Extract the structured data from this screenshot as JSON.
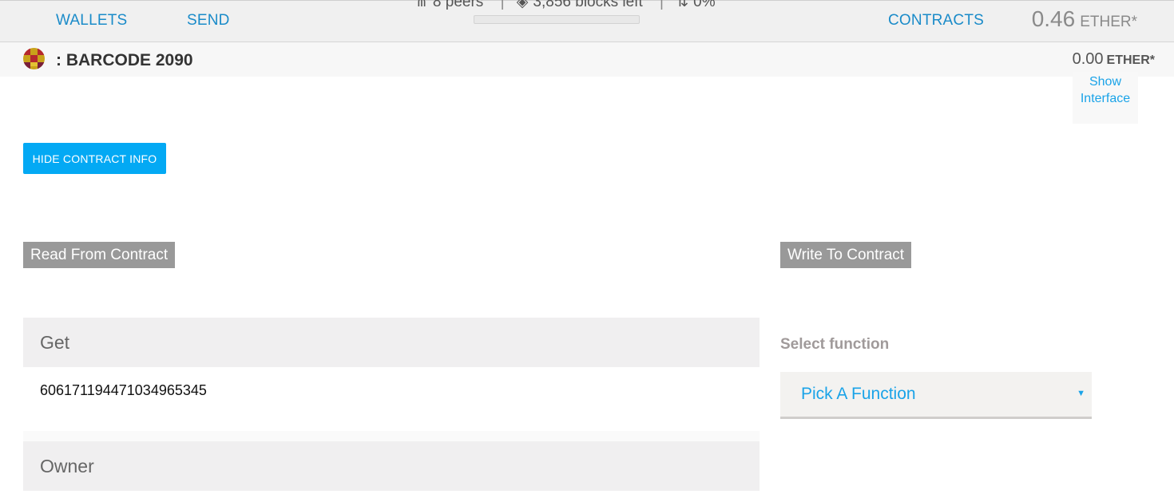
{
  "nav": {
    "wallets": "WALLETS",
    "send": "SEND",
    "contracts": "CONTRACTS",
    "balance_value": "0.46",
    "balance_unit": "ETHER*"
  },
  "status": {
    "peers": "8 peers",
    "blocks_left": "3,856 blocks left",
    "sync": "0%",
    "progress_fraction": 0
  },
  "account": {
    "name": ": BARCODE 2090",
    "balance_value": "0.00",
    "balance_unit": "ETHER*"
  },
  "show_interface": {
    "line1": "Show",
    "line2": "Interface"
  },
  "hide_contract_info_label": "HIDE CONTRACT INFO",
  "read_section": {
    "title": "Read From Contract",
    "fields": [
      {
        "name": "Get",
        "value": "606171194471034965345"
      },
      {
        "name": "Owner",
        "value": ""
      }
    ]
  },
  "write_section": {
    "title": "Write To Contract",
    "select_label": "Select function",
    "select_value": "Pick A Function"
  },
  "colors": {
    "accent": "#03a9f4",
    "link": "#1a8bc9",
    "tag_bg": "#999999"
  }
}
